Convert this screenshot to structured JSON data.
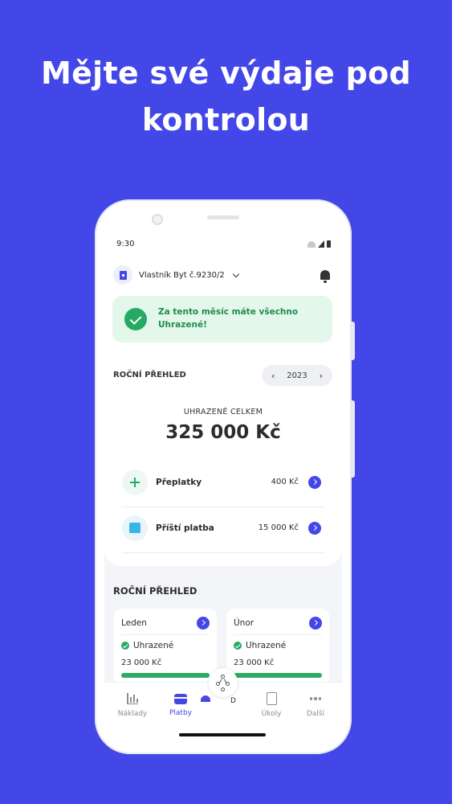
{
  "headline": "Mějte své výdaje pod kontrolou",
  "status": {
    "time": "9:30"
  },
  "header": {
    "account_name": "Vlastník Byt č.9230/2"
  },
  "alert": {
    "text": "Za tento měsíc máte všechno Uhrazené!"
  },
  "overview": {
    "title": "ROČNÍ PŘEHLED",
    "year": "2023",
    "prev_arrow": "‹",
    "next_arrow": "›",
    "total_label": "UHRAZENÉ CELKEM",
    "total_value": "325 000 Kč"
  },
  "rows": [
    {
      "label": "Přeplatky",
      "amount": "400 Kč"
    },
    {
      "label": "Příští platba",
      "amount": "15 000 Kč"
    }
  ],
  "months_section": {
    "title": "ROČNÍ PŘEHLED",
    "months": [
      {
        "name": "Leden",
        "status": "Uhrazené",
        "amount": "23 000 Kč",
        "progress": 1.0
      },
      {
        "name": "Únor",
        "status": "Uhrazené",
        "amount": "23 000 Kč",
        "progress": 1.0
      }
    ]
  },
  "nav": {
    "items": [
      {
        "label": "Náklady",
        "icon": "chart-icon"
      },
      {
        "label": "Platby",
        "icon": "card-icon",
        "active": true
      },
      {
        "label": "Úkoly",
        "icon": "tasks-icon"
      },
      {
        "label": "Další",
        "icon": "more-icon"
      }
    ],
    "partial_label": "D"
  },
  "colors": {
    "background": "#4347e8",
    "accent": "#4347e8",
    "success": "#26a963",
    "success_bg": "#e3f7ea"
  }
}
